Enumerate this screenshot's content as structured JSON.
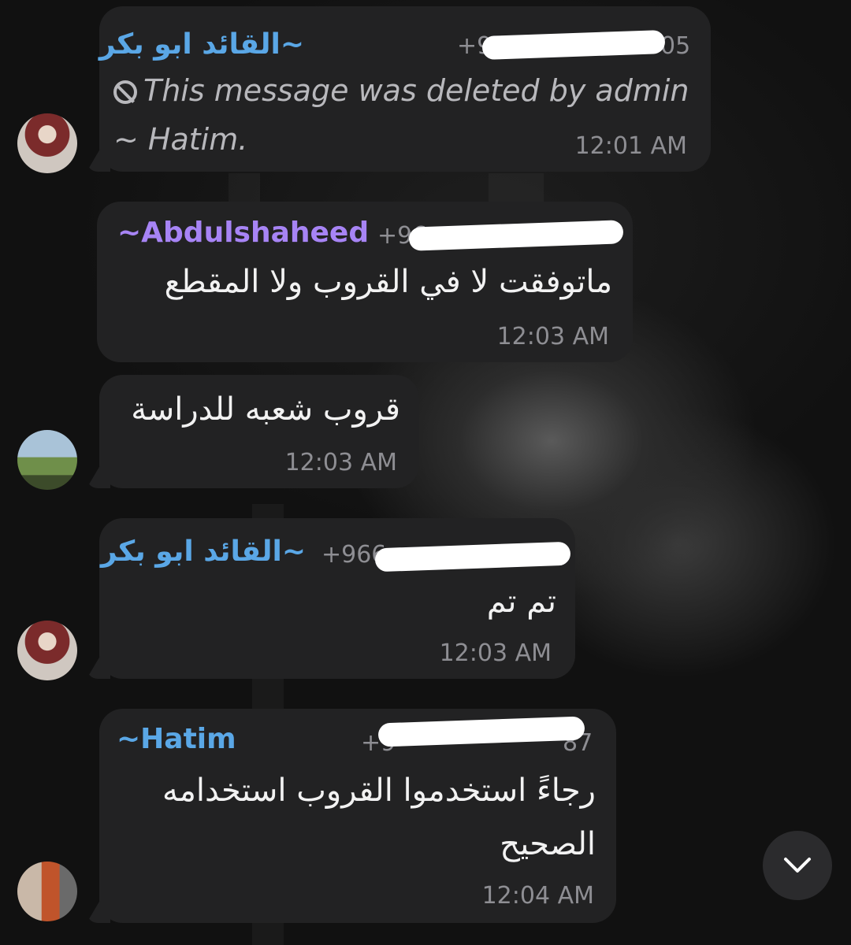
{
  "colors": {
    "bubble": "#222223",
    "name_blue": "#5aa7e6",
    "name_purple": "#a784f5",
    "meta_gray": "#8e8e93",
    "background": "#0f0f0f"
  },
  "messages": [
    {
      "sender": "~القائد ابو بكر",
      "sender_color": "#5aa7e6",
      "phone_start": "+96",
      "phone_end": "05",
      "deleted_text": "This message was deleted by admin",
      "deleted_by": "~ Hatim.",
      "deleted_icon": "ban-icon",
      "time": "12:01 AM"
    },
    {
      "sender": "~Abdulshaheed",
      "sender_color": "#a784f5",
      "phone_start": "+96",
      "text": "ماتوفقت لا في القروب ولا المقطع",
      "time": "12:03 AM"
    },
    {
      "text": "قروب شعبه للدراسة",
      "time": "12:03 AM"
    },
    {
      "sender": "~القائد ابو بكر",
      "sender_color": "#5aa7e6",
      "phone_start": "+966",
      "text": "تم تم",
      "time": "12:03 AM"
    },
    {
      "sender": "~Hatim",
      "sender_color": "#5aa7e6",
      "phone_start": "+9",
      "phone_end": "87",
      "text_line1": "رجاءً استخدموا القروب استخدامه",
      "text_line2": "الصحيح",
      "time": "12:04 AM"
    }
  ],
  "scroll_button": {
    "icon": "chevron-down-icon"
  }
}
